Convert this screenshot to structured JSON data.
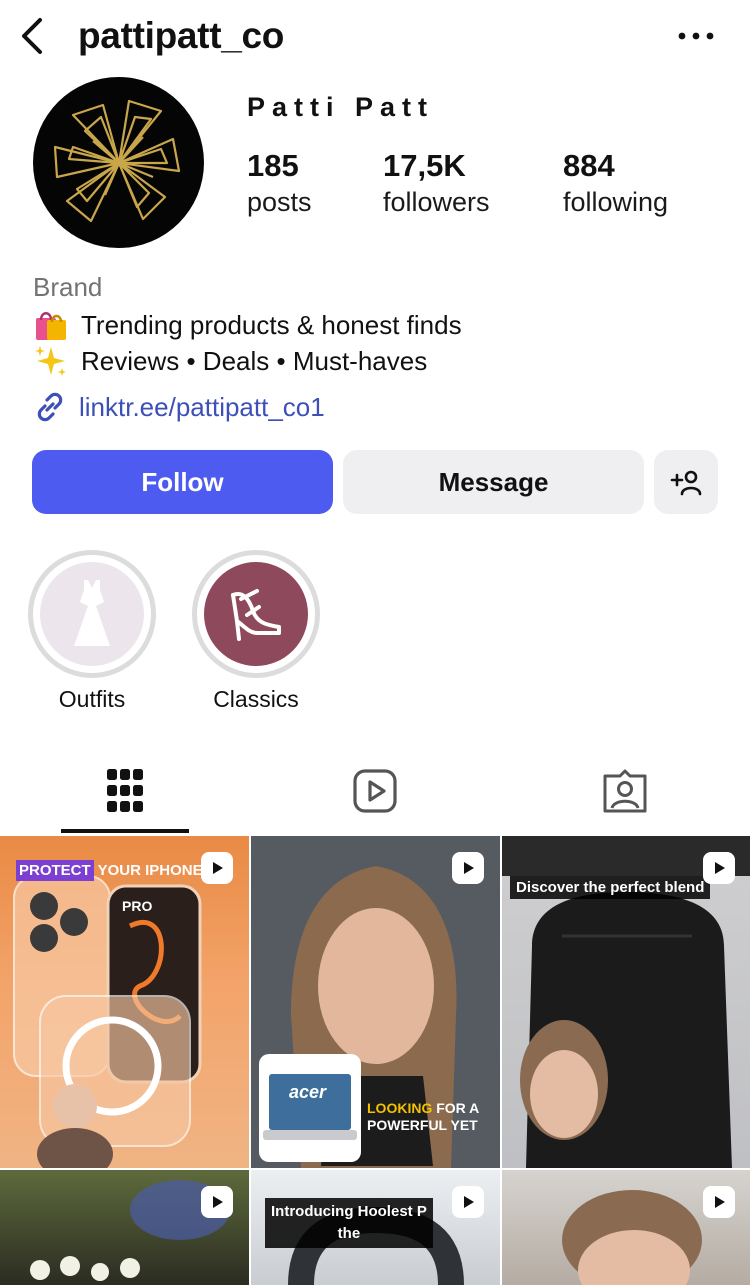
{
  "header": {
    "username": "pattipatt_co"
  },
  "profile": {
    "display_name": "Patti Patt",
    "stats": [
      {
        "value": "185",
        "label": "posts"
      },
      {
        "value": "17,5K",
        "label": "followers"
      },
      {
        "value": "884",
        "label": "following"
      }
    ],
    "category": "Brand",
    "bio_lines": [
      {
        "icon": "shopping-bags-emoji",
        "text": "Trending products & honest finds"
      },
      {
        "icon": "sparkles-emoji",
        "text": "Reviews • Deals • Must-haves"
      }
    ],
    "link": "linktr.ee/pattipatt_co1"
  },
  "actions": {
    "follow_label": "Follow",
    "message_label": "Message",
    "add_user_icon": "add-person-icon"
  },
  "highlights": [
    {
      "label": "Outfits",
      "icon": "dress-icon"
    },
    {
      "label": "Classics",
      "icon": "high-heel-icon"
    }
  ],
  "tabs": [
    {
      "name": "grid",
      "icon": "grid-icon",
      "active": true
    },
    {
      "name": "reels",
      "icon": "reels-icon",
      "active": false
    },
    {
      "name": "tagged",
      "icon": "tagged-icon",
      "active": false
    }
  ],
  "posts": [
    {
      "type": "reel",
      "caption_parts": [
        "PROTECT",
        "YOUR IPHONE",
        "PRO"
      ]
    },
    {
      "type": "reel",
      "caption_parts": [
        "LOOKING",
        "FOR A",
        "POWERFUL YET"
      ],
      "product_label": "acer"
    },
    {
      "type": "reel",
      "caption": "Discover the perfect blend"
    },
    {
      "type": "reel"
    },
    {
      "type": "reel",
      "caption_parts": [
        "Introducing Hoolest P",
        "the"
      ]
    },
    {
      "type": "reel"
    }
  ],
  "colors": {
    "follow_button": "#4e5bf0",
    "secondary_button": "#efeff1",
    "link": "#3d4fb8",
    "avatar_bg": "#050505",
    "avatar_logo": "#c9a64a",
    "classics_bg": "#8e4a5c"
  }
}
